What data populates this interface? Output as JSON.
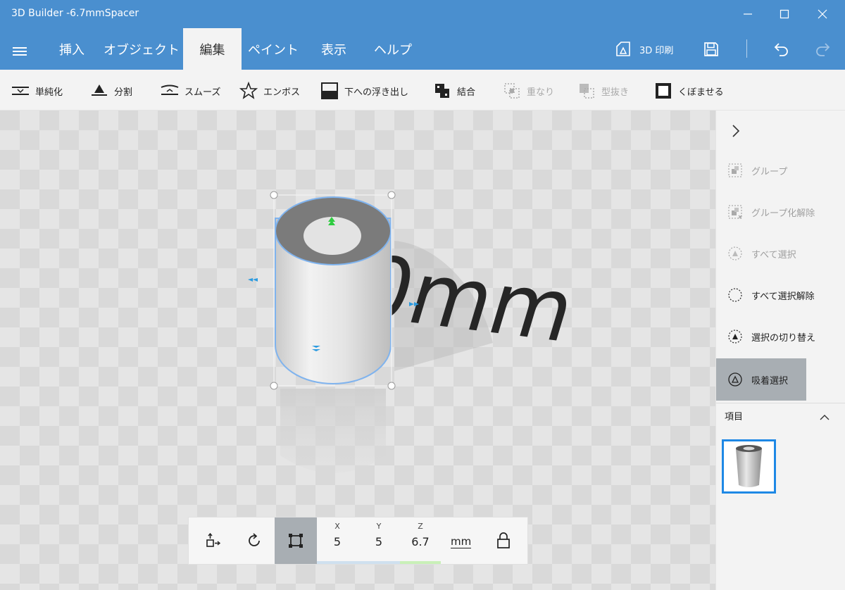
{
  "window": {
    "title": "3D Builder -6.7mmSpacer"
  },
  "menu": {
    "tabs": [
      {
        "label": "挿入"
      },
      {
        "label": "オブジェクト"
      },
      {
        "label": "編集"
      },
      {
        "label": "ペイント"
      },
      {
        "label": "表示"
      },
      {
        "label": "ヘルプ"
      }
    ],
    "active_tab": "編集",
    "print_label": "3D 印刷"
  },
  "toolbar": {
    "items": [
      {
        "label": "単純化",
        "enabled": true,
        "icon": "simplify-icon"
      },
      {
        "label": "分割",
        "enabled": true,
        "icon": "split-icon"
      },
      {
        "label": "スムーズ",
        "enabled": true,
        "icon": "smooth-icon"
      },
      {
        "label": "エンボス",
        "enabled": true,
        "icon": "star-icon"
      },
      {
        "label": "下への浮き出し",
        "enabled": true,
        "icon": "extrude-down-icon"
      },
      {
        "label": "結合",
        "enabled": true,
        "icon": "merge-icon"
      },
      {
        "label": "重なり",
        "enabled": false,
        "icon": "intersect-icon"
      },
      {
        "label": "型抜き",
        "enabled": false,
        "icon": "subtract-icon"
      },
      {
        "label": "くぼませる",
        "enabled": true,
        "icon": "hollow-icon"
      }
    ]
  },
  "scene": {
    "background_text": "0mm"
  },
  "transform": {
    "x_label": "X",
    "x_value": "5",
    "y_label": "Y",
    "y_value": "5",
    "z_label": "Z",
    "z_value": "6.7",
    "unit": "mm"
  },
  "side_panel": {
    "items": [
      {
        "label": "グループ",
        "enabled": false
      },
      {
        "label": "グループ化解除",
        "enabled": false
      },
      {
        "label": "すべて選択",
        "enabled": false
      },
      {
        "label": "すべて選択解除",
        "enabled": true
      },
      {
        "label": "選択の切り替え",
        "enabled": true
      },
      {
        "label": "吸着選択",
        "enabled": true,
        "active": true
      }
    ],
    "items_title": "項目"
  },
  "colors": {
    "accent": "#4a8fcf",
    "selection": "#1e88e5",
    "panel": "#f3f3f3"
  }
}
